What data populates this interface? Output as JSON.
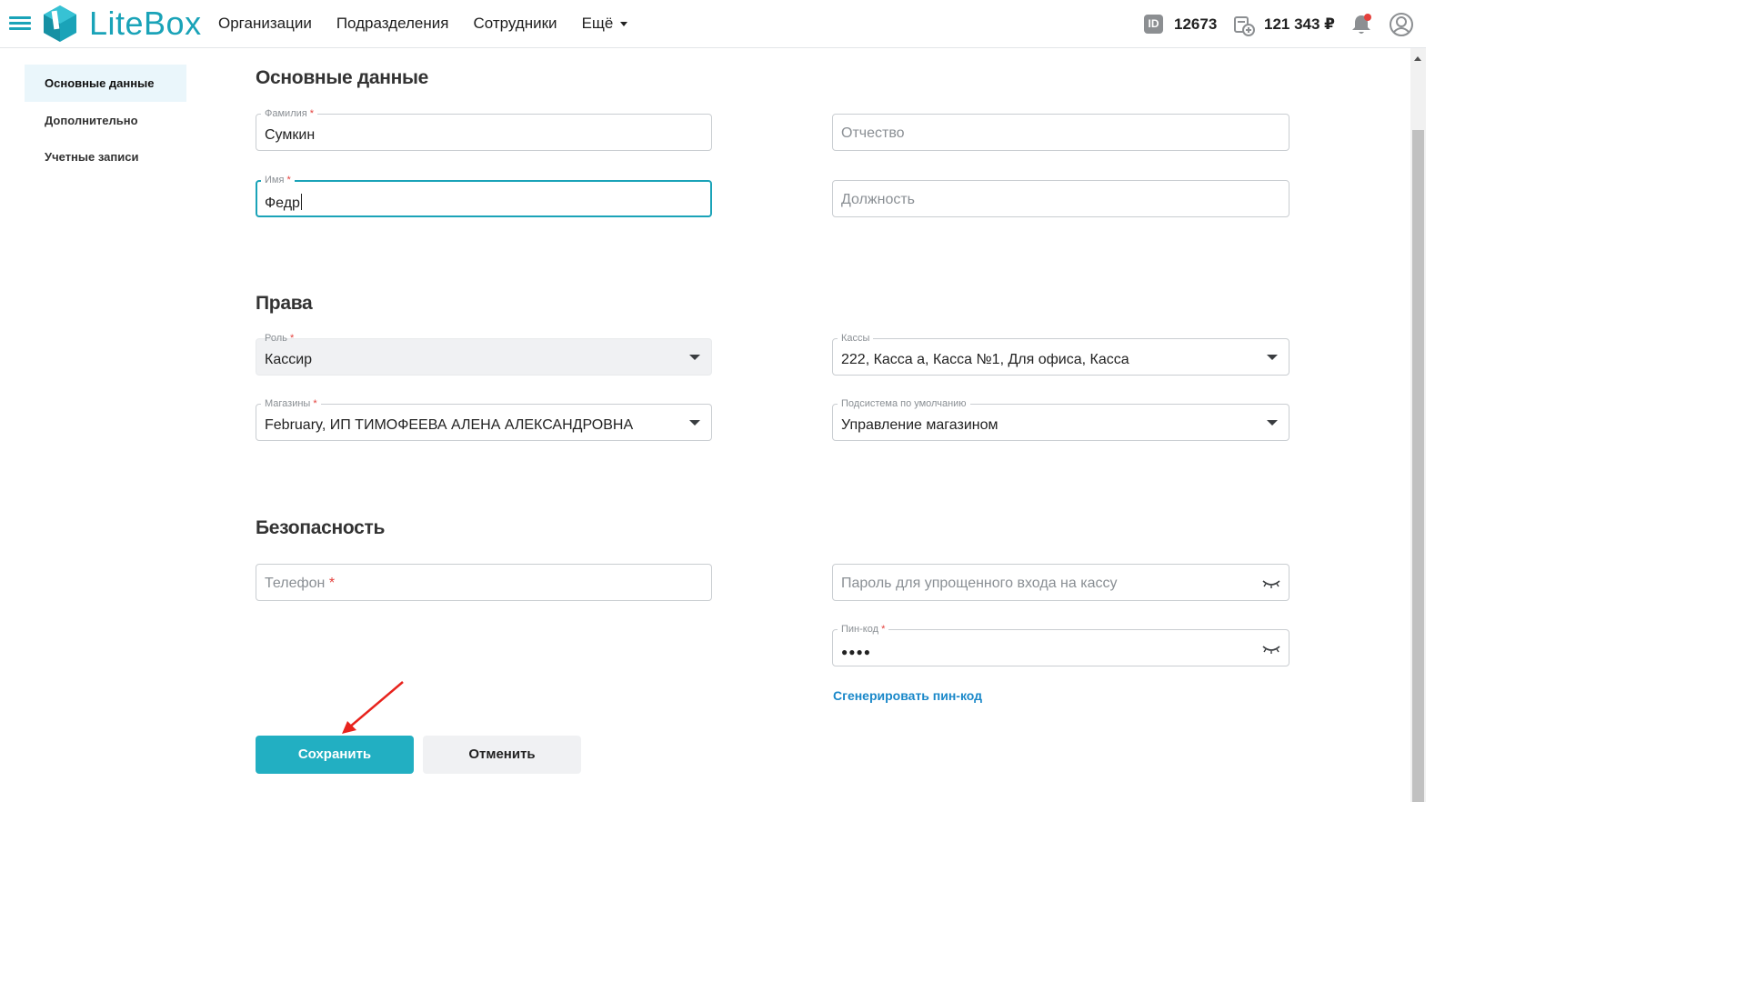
{
  "header": {
    "logo_text": "LiteBox",
    "nav": [
      "Организации",
      "Подразделения",
      "Сотрудники"
    ],
    "more_label": "Ещё",
    "id_badge": "ID",
    "id_number": "12673",
    "balance": "121 343 ₽",
    "accent_color": "#1aa3b8"
  },
  "sidebar": {
    "items": [
      {
        "label": "Основные данные",
        "active": true
      },
      {
        "label": "Дополнительно",
        "active": false
      },
      {
        "label": "Учетные записи",
        "active": false
      }
    ]
  },
  "basic": {
    "title": "Основные данные",
    "surname": {
      "label": "Фамилия",
      "value": "Сумкин"
    },
    "patronymic": {
      "placeholder": "Отчество"
    },
    "name": {
      "label": "Имя",
      "value": "Федр"
    },
    "position": {
      "placeholder": "Должность"
    }
  },
  "rights": {
    "title": "Права",
    "role": {
      "label": "Роль",
      "value": "Кассир"
    },
    "registers": {
      "label": "Кассы",
      "value": "222, Касса а, Касса №1, Для офиса, Касса"
    },
    "stores": {
      "label": "Магазины",
      "value": "February, ИП ТИМОФЕЕВА АЛЕНА АЛЕКСАНДРОВНА"
    },
    "subsystem": {
      "label": "Подсистема по умолчанию",
      "value": "Управление магазином"
    }
  },
  "security": {
    "title": "Безопасность",
    "phone": {
      "placeholder": "Телефон"
    },
    "password": {
      "placeholder": "Пароль для упрощенного входа на кассу"
    },
    "pin": {
      "label": "Пин-код",
      "value": "●●●●"
    },
    "generate_link": "Сгенерировать пин-код"
  },
  "actions": {
    "save": "Сохранить",
    "cancel": "Отменить"
  },
  "required_mark": "*"
}
